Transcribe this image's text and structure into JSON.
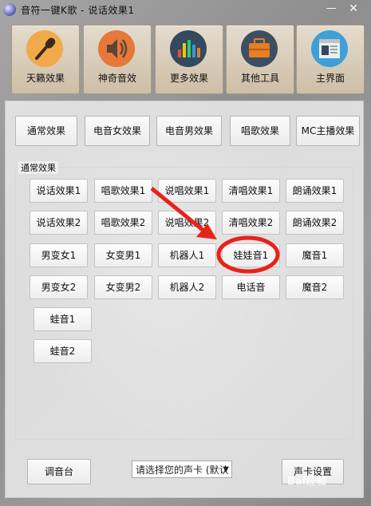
{
  "window": {
    "title": "音符一键K歌 - 说话效果1",
    "minimize_glyph": "—",
    "close_glyph": "✕"
  },
  "top_nav": [
    {
      "label": "天籁效果",
      "icon": "microphone-icon",
      "color": "#f2a94a"
    },
    {
      "label": "神奇音效",
      "icon": "speaker-icon",
      "color": "#e6783a"
    },
    {
      "label": "更多效果",
      "icon": "equalizer-icon",
      "color": "#34495e"
    },
    {
      "label": "其他工具",
      "icon": "toolbox-icon",
      "color": "#3d4e63"
    },
    {
      "label": "主界面",
      "icon": "browser-window-icon",
      "color": "#3f9fd8"
    }
  ],
  "category_tabs": [
    "通常效果",
    "电音女效果",
    "电音男效果",
    "唱歌效果",
    "MC主播效果"
  ],
  "group": {
    "label": "通常效果",
    "rows": [
      [
        "说话效果1",
        "唱歌效果1",
        "说唱效果1",
        "清唱效果1",
        "朗诵效果1"
      ],
      [
        "说话效果2",
        "唱歌效果2",
        "说唱效果2",
        "清唱效果2",
        "朗诵效果2"
      ],
      [
        "男变女1",
        "女变男1",
        "机器人1",
        "娃娃音1",
        "魔音1"
      ],
      [
        "男变女2",
        "女变男2",
        "机器人2",
        "电话音",
        "魔音2"
      ],
      [
        "蛙音1"
      ],
      [
        "蛙音2"
      ]
    ],
    "highlighted": "娃娃音1"
  },
  "bottom": {
    "mixer_label": "调音台",
    "soundcard_select": "请选择您的声卡 (默认",
    "soundcard_settings_label": "声卡设置"
  },
  "annotation": {
    "arrow_color": "#e8231a",
    "circle_color": "#e8231a"
  },
  "watermark": "Bai经验"
}
